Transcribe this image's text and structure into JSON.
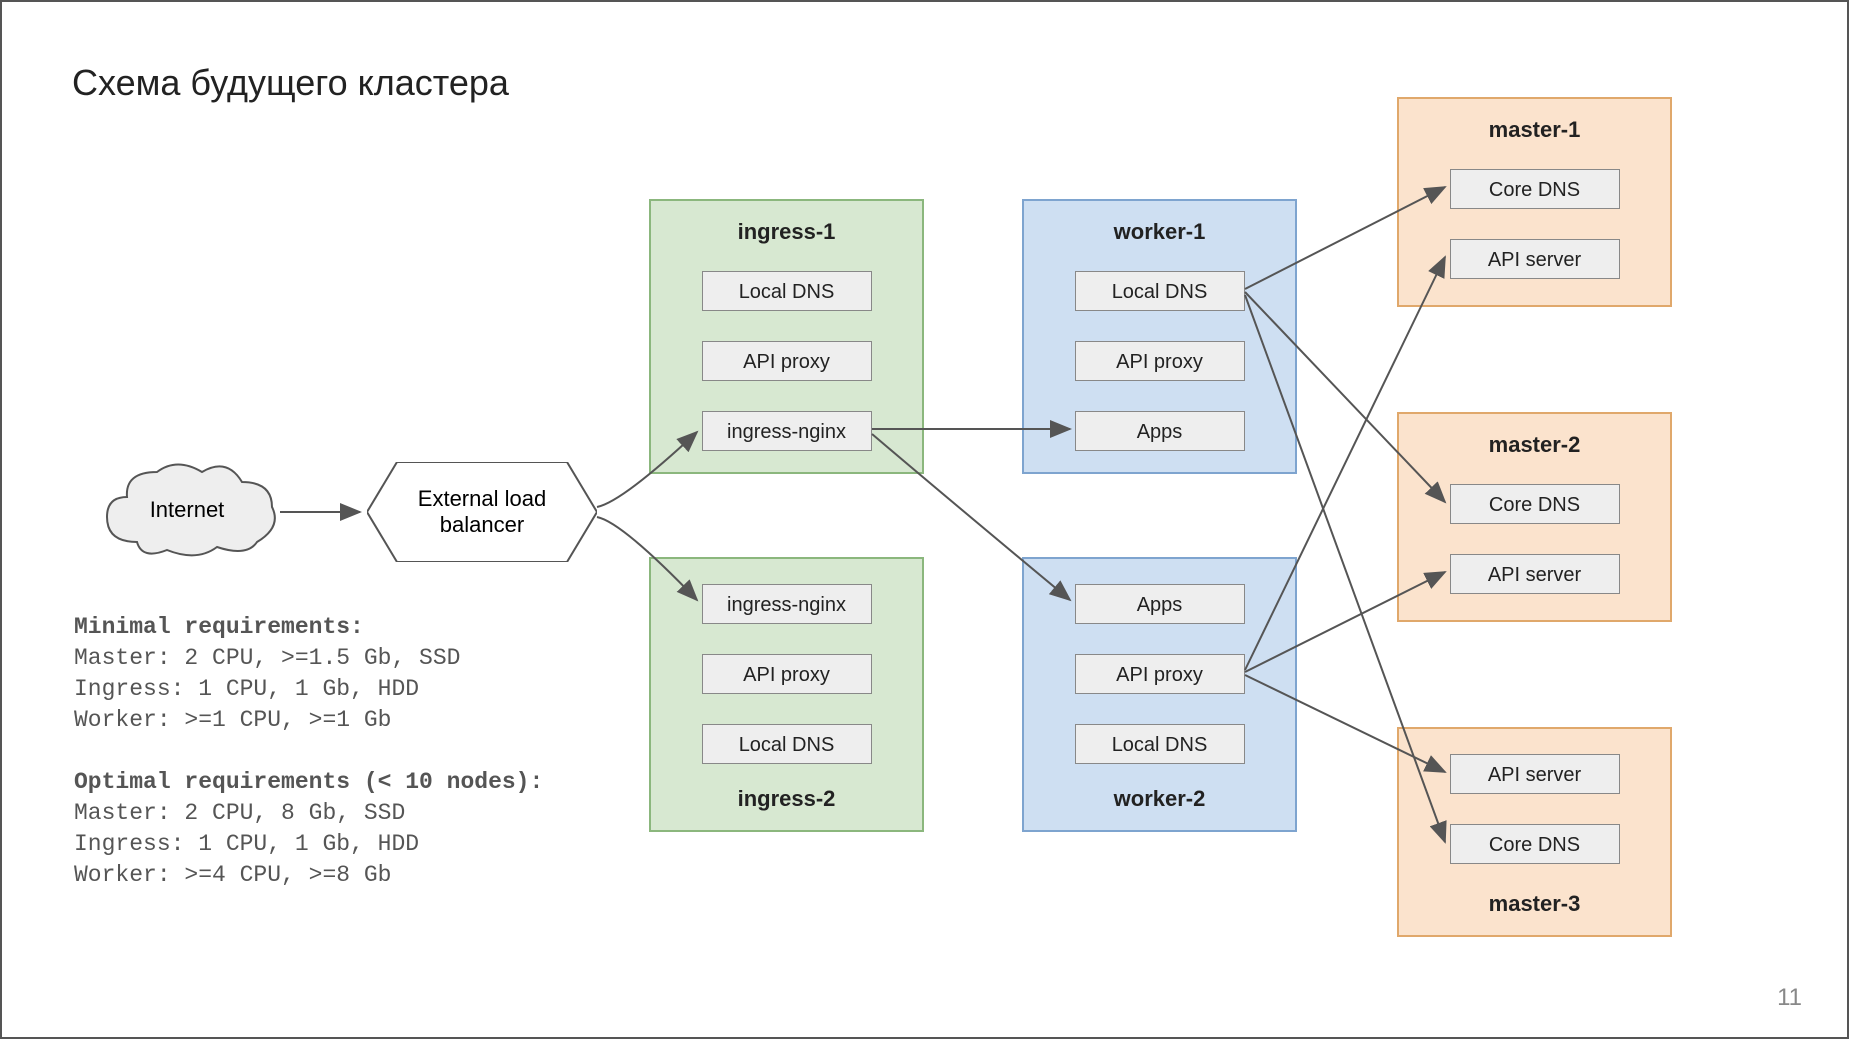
{
  "title": "Схема будущего кластера",
  "page_number": "11",
  "internet_label": "Internet",
  "lb_label": "External load balancer",
  "ingress1": {
    "title": "ingress-1",
    "items": [
      "Local DNS",
      "API proxy",
      "ingress-nginx"
    ]
  },
  "ingress2": {
    "title": "ingress-2",
    "items": [
      "ingress-nginx",
      "API proxy",
      "Local DNS"
    ]
  },
  "worker1": {
    "title": "worker-1",
    "items": [
      "Local DNS",
      "API proxy",
      "Apps"
    ]
  },
  "worker2": {
    "title": "worker-2",
    "items": [
      "Apps",
      "API proxy",
      "Local DNS"
    ]
  },
  "master1": {
    "title": "master-1",
    "items": [
      "Core DNS",
      "API server"
    ]
  },
  "master2": {
    "title": "master-2",
    "items": [
      "Core DNS",
      "API server"
    ]
  },
  "master3": {
    "title": "master-3",
    "items": [
      "API server",
      "Core DNS"
    ]
  },
  "requirements": {
    "minimal_header": "Minimal requirements:",
    "minimal_lines": [
      "Master: 2 CPU, >=1.5 Gb, SSD",
      "Ingress: 1 CPU, 1 Gb, HDD",
      "Worker: >=1 CPU, >=1 Gb"
    ],
    "optimal_header": "Optimal requirements (< 10 nodes):",
    "optimal_lines": [
      "Master: 2 CPU, 8 Gb, SSD",
      "Ingress: 1 CPU, 1 Gb, HDD",
      "Worker: >=4 CPU, >=8 Gb"
    ]
  },
  "colors": {
    "ingress_fill": "#d7e8d1",
    "worker_fill": "#cedff2",
    "master_fill": "#fbe3cd",
    "comp_fill": "#eeeeee",
    "arrow": "#555555"
  }
}
